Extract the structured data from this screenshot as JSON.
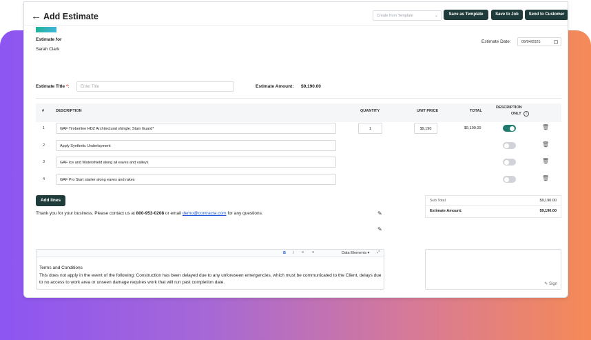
{
  "header": {
    "back_icon": "arrow-left-icon",
    "title": "Add Estimate",
    "template_placeholder": "Create from Template",
    "save_template_label": "Save as Template",
    "save_job_label": "Save to Job",
    "send_customer_label": "Send to Customer"
  },
  "customer": {
    "label": "Estimate for",
    "name": "Sarah Clark"
  },
  "estimate_date": {
    "label": "Estimate Date:",
    "value": "09/04/2025"
  },
  "estimate_title": {
    "label": "Estimate Title",
    "required_mark": "*:",
    "placeholder": "Enter Title"
  },
  "estimate_amount": {
    "label": "Estimate Amount:",
    "value": "$9,190.00"
  },
  "table": {
    "headers": {
      "num": "#",
      "description": "DESCRIPTION",
      "quantity": "QUANTITY",
      "unit_price": "UNIT PRICE",
      "total": "TOTAL",
      "desc_only_line1": "DESCRIPTION",
      "desc_only_line2": "ONLY"
    },
    "rows": [
      {
        "num": "1",
        "description": "GAF Timberline HDZ Architectural shingle; Stain Guard*",
        "quantity": "1",
        "unit_price": "$9,190",
        "total": "$9,190.00",
        "description_only": true
      },
      {
        "num": "2",
        "description": "Apply Synthetic Underlayment",
        "description_only": false
      },
      {
        "num": "3",
        "description": "GAF Ice and Watershield along all eaves and valleys",
        "description_only": false
      },
      {
        "num": "4",
        "description": "GAF Pro Start starter along eaves and rakes",
        "description_only": false
      }
    ]
  },
  "add_lines_label": "Add lines",
  "thanks": {
    "prefix": "Thank you for your business. Please contact us at ",
    "phone": "800-953-0208",
    "middle": " or email ",
    "email": "demo@contracta.com",
    "suffix": " for any questions."
  },
  "totals": {
    "subtotal_label": "Sub Total",
    "subtotal_value": "$9,190.00",
    "amount_label": "Estimate Amount:",
    "amount_value": "$9,190.00"
  },
  "terms": {
    "toolbar": {
      "bold": "B",
      "italic": "I",
      "data_elements": "Data Elements"
    },
    "heading": "Terms and Conditions",
    "body": "This does not apply in the event of the following:  Construction has been delayed due to any unforeseen emergencies, which must be communicated to the Client, delays due to no access to work area or unseen damage requires work that will run past completion date."
  },
  "sign_label": "Sign",
  "colors": {
    "primary": "#1f3b3a",
    "toggle_on": "#1f7a6e",
    "link": "#1a56d6",
    "required": "#e53935"
  }
}
